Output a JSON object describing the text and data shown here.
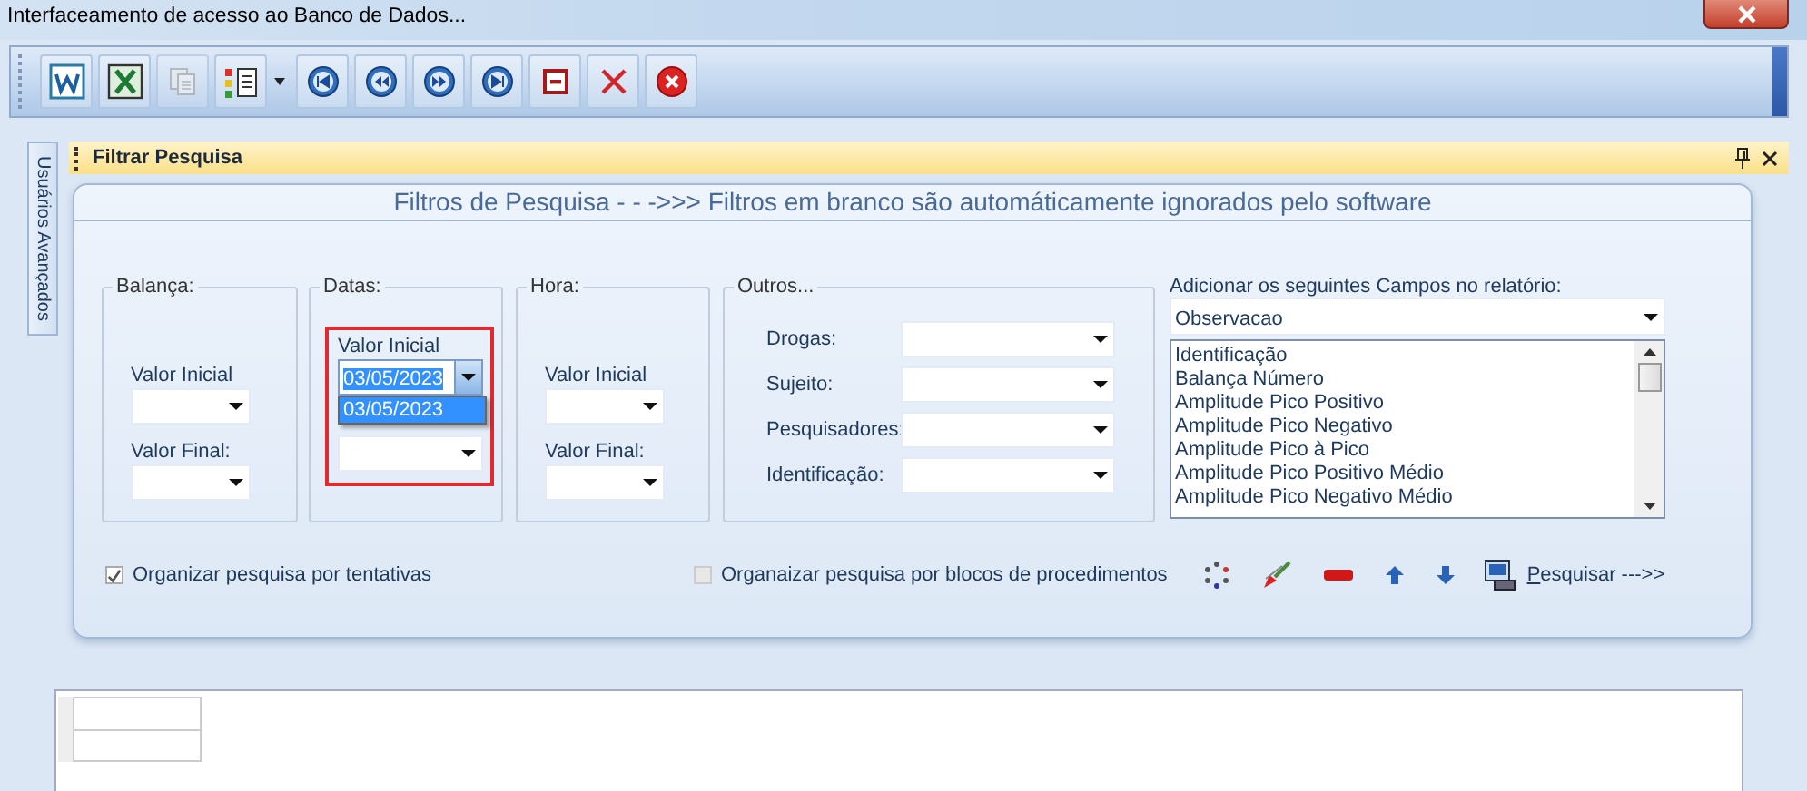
{
  "window": {
    "title": "Interfaceamento de acesso ao Banco de Dados..."
  },
  "toolbar": [
    {
      "kind": "document",
      "disabled": false
    },
    {
      "kind": "spreadsheet",
      "disabled": false
    },
    {
      "kind": "copy",
      "disabled": true
    },
    {
      "kind": "list",
      "disabled": false
    },
    {
      "kind": "first",
      "disabled": false
    },
    {
      "kind": "previous",
      "disabled": false
    },
    {
      "kind": "next",
      "disabled": false
    },
    {
      "kind": "last",
      "disabled": false
    },
    {
      "kind": "remove",
      "disabled": false
    },
    {
      "kind": "delete",
      "disabled": false
    },
    {
      "kind": "cancel",
      "disabled": false
    }
  ],
  "side_tab": {
    "label": "Usuários Avançados"
  },
  "panel": {
    "title": "Filtrar Pesquisa"
  },
  "banner": "Filtros de Pesquisa - - ->>> Filtros em branco são automáticamente ignorados pelo software",
  "groups": [
    {
      "title": "Balança:",
      "kind": "stacked",
      "highlighted": false,
      "fields": [
        {
          "label": "Valor Inicial",
          "expanded": false
        },
        {
          "label": "Valor Final:",
          "expanded": false
        }
      ]
    },
    {
      "title": "Datas:",
      "kind": "stacked",
      "highlighted": true,
      "fields": [
        {
          "label": "Valor Inicial",
          "value": "03/05/2023",
          "expanded": true,
          "options": [
            {
              "label": "03/05/2023",
              "selected": true
            }
          ]
        },
        {
          "expanded": false
        }
      ]
    },
    {
      "title": "Hora:",
      "kind": "stacked",
      "highlighted": false,
      "fields": [
        {
          "label": "Valor Inicial",
          "expanded": false
        },
        {
          "label": "Valor Final:",
          "expanded": false
        }
      ]
    },
    {
      "title": "Outros...",
      "kind": "rows",
      "highlighted": false,
      "fields": [
        {
          "label": "Drogas:",
          "expanded": false
        },
        {
          "label": "Sujeito:",
          "expanded": false
        },
        {
          "label": "Pesquisadores:",
          "expanded": false
        },
        {
          "label": "Identificação:",
          "expanded": false
        }
      ]
    }
  ],
  "report_fields": {
    "label": "Adicionar os seguintes Campos no relatório:",
    "value": "Observacao",
    "items": [
      "Identificação",
      "Balança Número",
      "Amplitude Pico Positivo",
      "Amplitude Pico Negativo",
      "Amplitude Pico à Pico",
      "Amplitude Pico Positivo Médio",
      "Amplitude Pico Negativo Médio"
    ]
  },
  "checkboxes": [
    {
      "label": "Organizar pesquisa por tentativas",
      "checked": true,
      "disabled": false
    },
    {
      "label": "Organaizar pesquisa por blocos de procedimentos",
      "checked": false,
      "disabled": true
    }
  ],
  "actions": [
    {
      "kind": "dots"
    },
    {
      "kind": "brush"
    },
    {
      "kind": "minus"
    },
    {
      "kind": "up"
    },
    {
      "kind": "down"
    }
  ],
  "search_button": {
    "label": "Pesquisar --->>"
  }
}
